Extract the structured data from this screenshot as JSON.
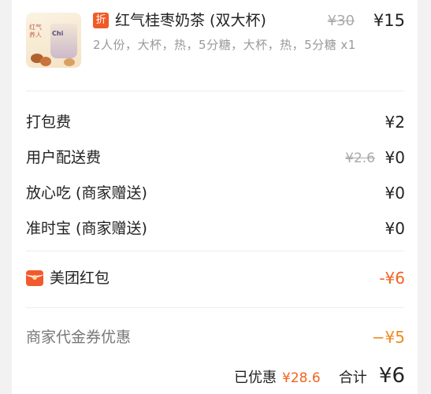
{
  "product": {
    "image_text_side": "红气养人",
    "image_text_cup": "Chi",
    "discount_tag": "折",
    "name": "红气桂枣奶茶 (双大杯)",
    "original_price": "¥30",
    "price": "¥15",
    "spec": "2人份，大杯，热，5分糖，大杯，热，5分糖 x1"
  },
  "fees": [
    {
      "label": "打包费",
      "value": "¥2"
    },
    {
      "label": "用户配送费",
      "original": "¥2.6",
      "value": "¥0"
    },
    {
      "label": "放心吃 (商家赠送)",
      "value": "¥0"
    },
    {
      "label": "准时宝 (商家赠送)",
      "value": "¥0"
    }
  ],
  "red_packet": {
    "icon": "red-packet-icon",
    "label": "美团红包",
    "value": "-¥6"
  },
  "coupon": {
    "label": "商家代金券优惠",
    "value": "−¥5"
  },
  "summary": {
    "discount_label": "已优惠",
    "discount_value": "¥28.6",
    "total_label": "合计",
    "total_value": "¥6"
  },
  "colors": {
    "accent": "#f0641e",
    "coupon": "#f08a1e",
    "tag": "#f05a27"
  }
}
